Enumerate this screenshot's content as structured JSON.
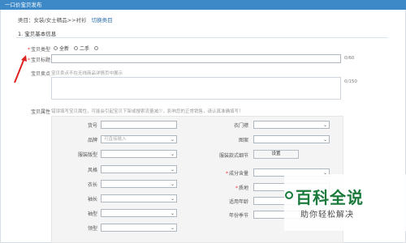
{
  "header": {
    "title": "一口价宝贝发布"
  },
  "category": {
    "path": "类目：女装/女士精品>>衬衫",
    "switch_label": "切换类目"
  },
  "section": {
    "title": "1. 宝贝基本信息"
  },
  "basic": {
    "type_label": "宝贝类型",
    "type_options": [
      "全新",
      "二手"
    ],
    "title_label": "宝贝标题",
    "title_count": "0/60",
    "selling_label": "宝贝卖点",
    "selling_hint": "宝贝卖点不在无线商品详情页中展示",
    "selling_count": "0/150",
    "attr_label": "宝贝属性",
    "attr_hint_prefix": "错误填写宝贝属性，可能会引起宝贝下架或搜索流量减少，影响您的正常销售，请认真准确填写！"
  },
  "attributes": {
    "left": [
      {
        "label": "货号",
        "value": "",
        "select": false
      },
      {
        "label": "品牌",
        "value": "可直接输入",
        "select": true
      },
      {
        "label": "服装版型",
        "value": "",
        "select": true
      },
      {
        "label": "风格",
        "value": "",
        "select": true
      },
      {
        "label": "衣长",
        "value": "",
        "select": true
      },
      {
        "label": "袖长",
        "value": "",
        "select": true
      },
      {
        "label": "袖型",
        "value": "",
        "select": true
      },
      {
        "label": "领型",
        "value": "",
        "select": true
      }
    ],
    "right": [
      {
        "label": "衣门襟",
        "required": false
      },
      {
        "label": "图案",
        "required": false
      },
      {
        "label": "服装款式细节",
        "required": false,
        "button": "设置"
      },
      {
        "label": "成分含量",
        "required": true
      },
      {
        "label": "质地",
        "required": true
      },
      {
        "label": "适用年龄",
        "required": false
      },
      {
        "label": "年份季节",
        "required": false
      }
    ]
  },
  "watermark": {
    "title": "百科全说",
    "subtitle": "助你轻松解决"
  },
  "colors": {
    "header_bg": "#3d89c7",
    "accent_link": "#2e6fb2",
    "required": "#e33333",
    "watermark": "#1a7a3b"
  }
}
